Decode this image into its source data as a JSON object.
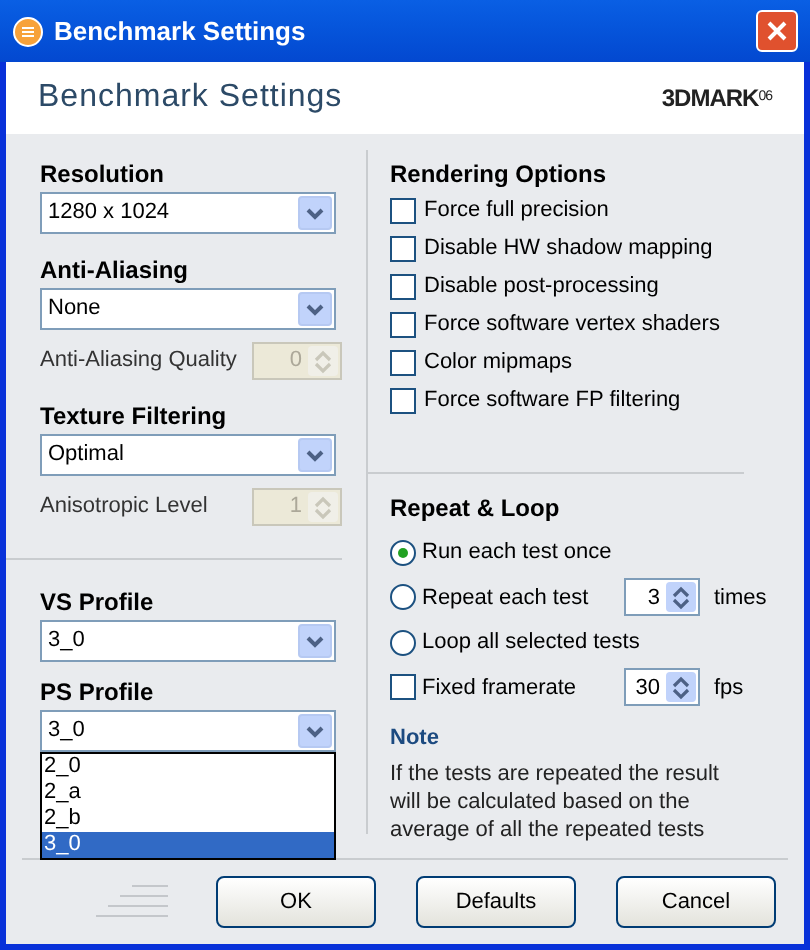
{
  "window": {
    "title": "Benchmark Settings"
  },
  "header": {
    "title": "Benchmark Settings",
    "logo": "3DMARK",
    "logo_suffix": "06"
  },
  "left_fields": [
    {
      "kind": "dropdown",
      "label": "Resolution",
      "value": "1280 x 1024"
    },
    {
      "kind": "dropdown",
      "label": "Anti-Aliasing",
      "value": "None"
    },
    {
      "kind": "spinner",
      "label": "Anti-Aliasing Quality",
      "value": "0",
      "disabled": true
    },
    {
      "kind": "dropdown",
      "label": "Texture Filtering",
      "value": "Optimal"
    },
    {
      "kind": "spinner",
      "label": "Anisotropic Level",
      "value": "1",
      "disabled": true
    }
  ],
  "profiles": [
    {
      "label": "VS Profile",
      "value": "3_0"
    },
    {
      "label": "PS Profile",
      "value": "3_0",
      "options": [
        {
          "label": "2_0",
          "selected": false
        },
        {
          "label": "2_a",
          "selected": false
        },
        {
          "label": "2_b",
          "selected": false
        },
        {
          "label": "3_0",
          "selected": true
        }
      ]
    }
  ],
  "rendering_options": {
    "title": "Rendering Options",
    "items": [
      {
        "label": "Force full precision",
        "checked": false
      },
      {
        "label": "Disable HW shadow mapping",
        "checked": false
      },
      {
        "label": "Disable post-processing",
        "checked": false
      },
      {
        "label": "Force software vertex shaders",
        "checked": false
      },
      {
        "label": "Color mipmaps",
        "checked": false
      },
      {
        "label": "Force software FP filtering",
        "checked": false
      }
    ]
  },
  "repeat_loop": {
    "title": "Repeat & Loop",
    "items": [
      {
        "kind": "radio",
        "label": "Run each test once",
        "selected": true
      },
      {
        "kind": "radio",
        "label": "Repeat each test",
        "selected": false,
        "value": "3",
        "unit": "times"
      },
      {
        "kind": "radio",
        "label": "Loop all selected tests",
        "selected": false
      },
      {
        "kind": "checkbox",
        "label": "Fixed framerate",
        "checked": false,
        "value": "30",
        "unit": "fps"
      }
    ]
  },
  "note": {
    "title": "Note",
    "text": "If the tests are repeated the result will be calculated based on the average of all the repeated tests"
  },
  "buttons": [
    "OK",
    "Defaults",
    "Cancel"
  ]
}
